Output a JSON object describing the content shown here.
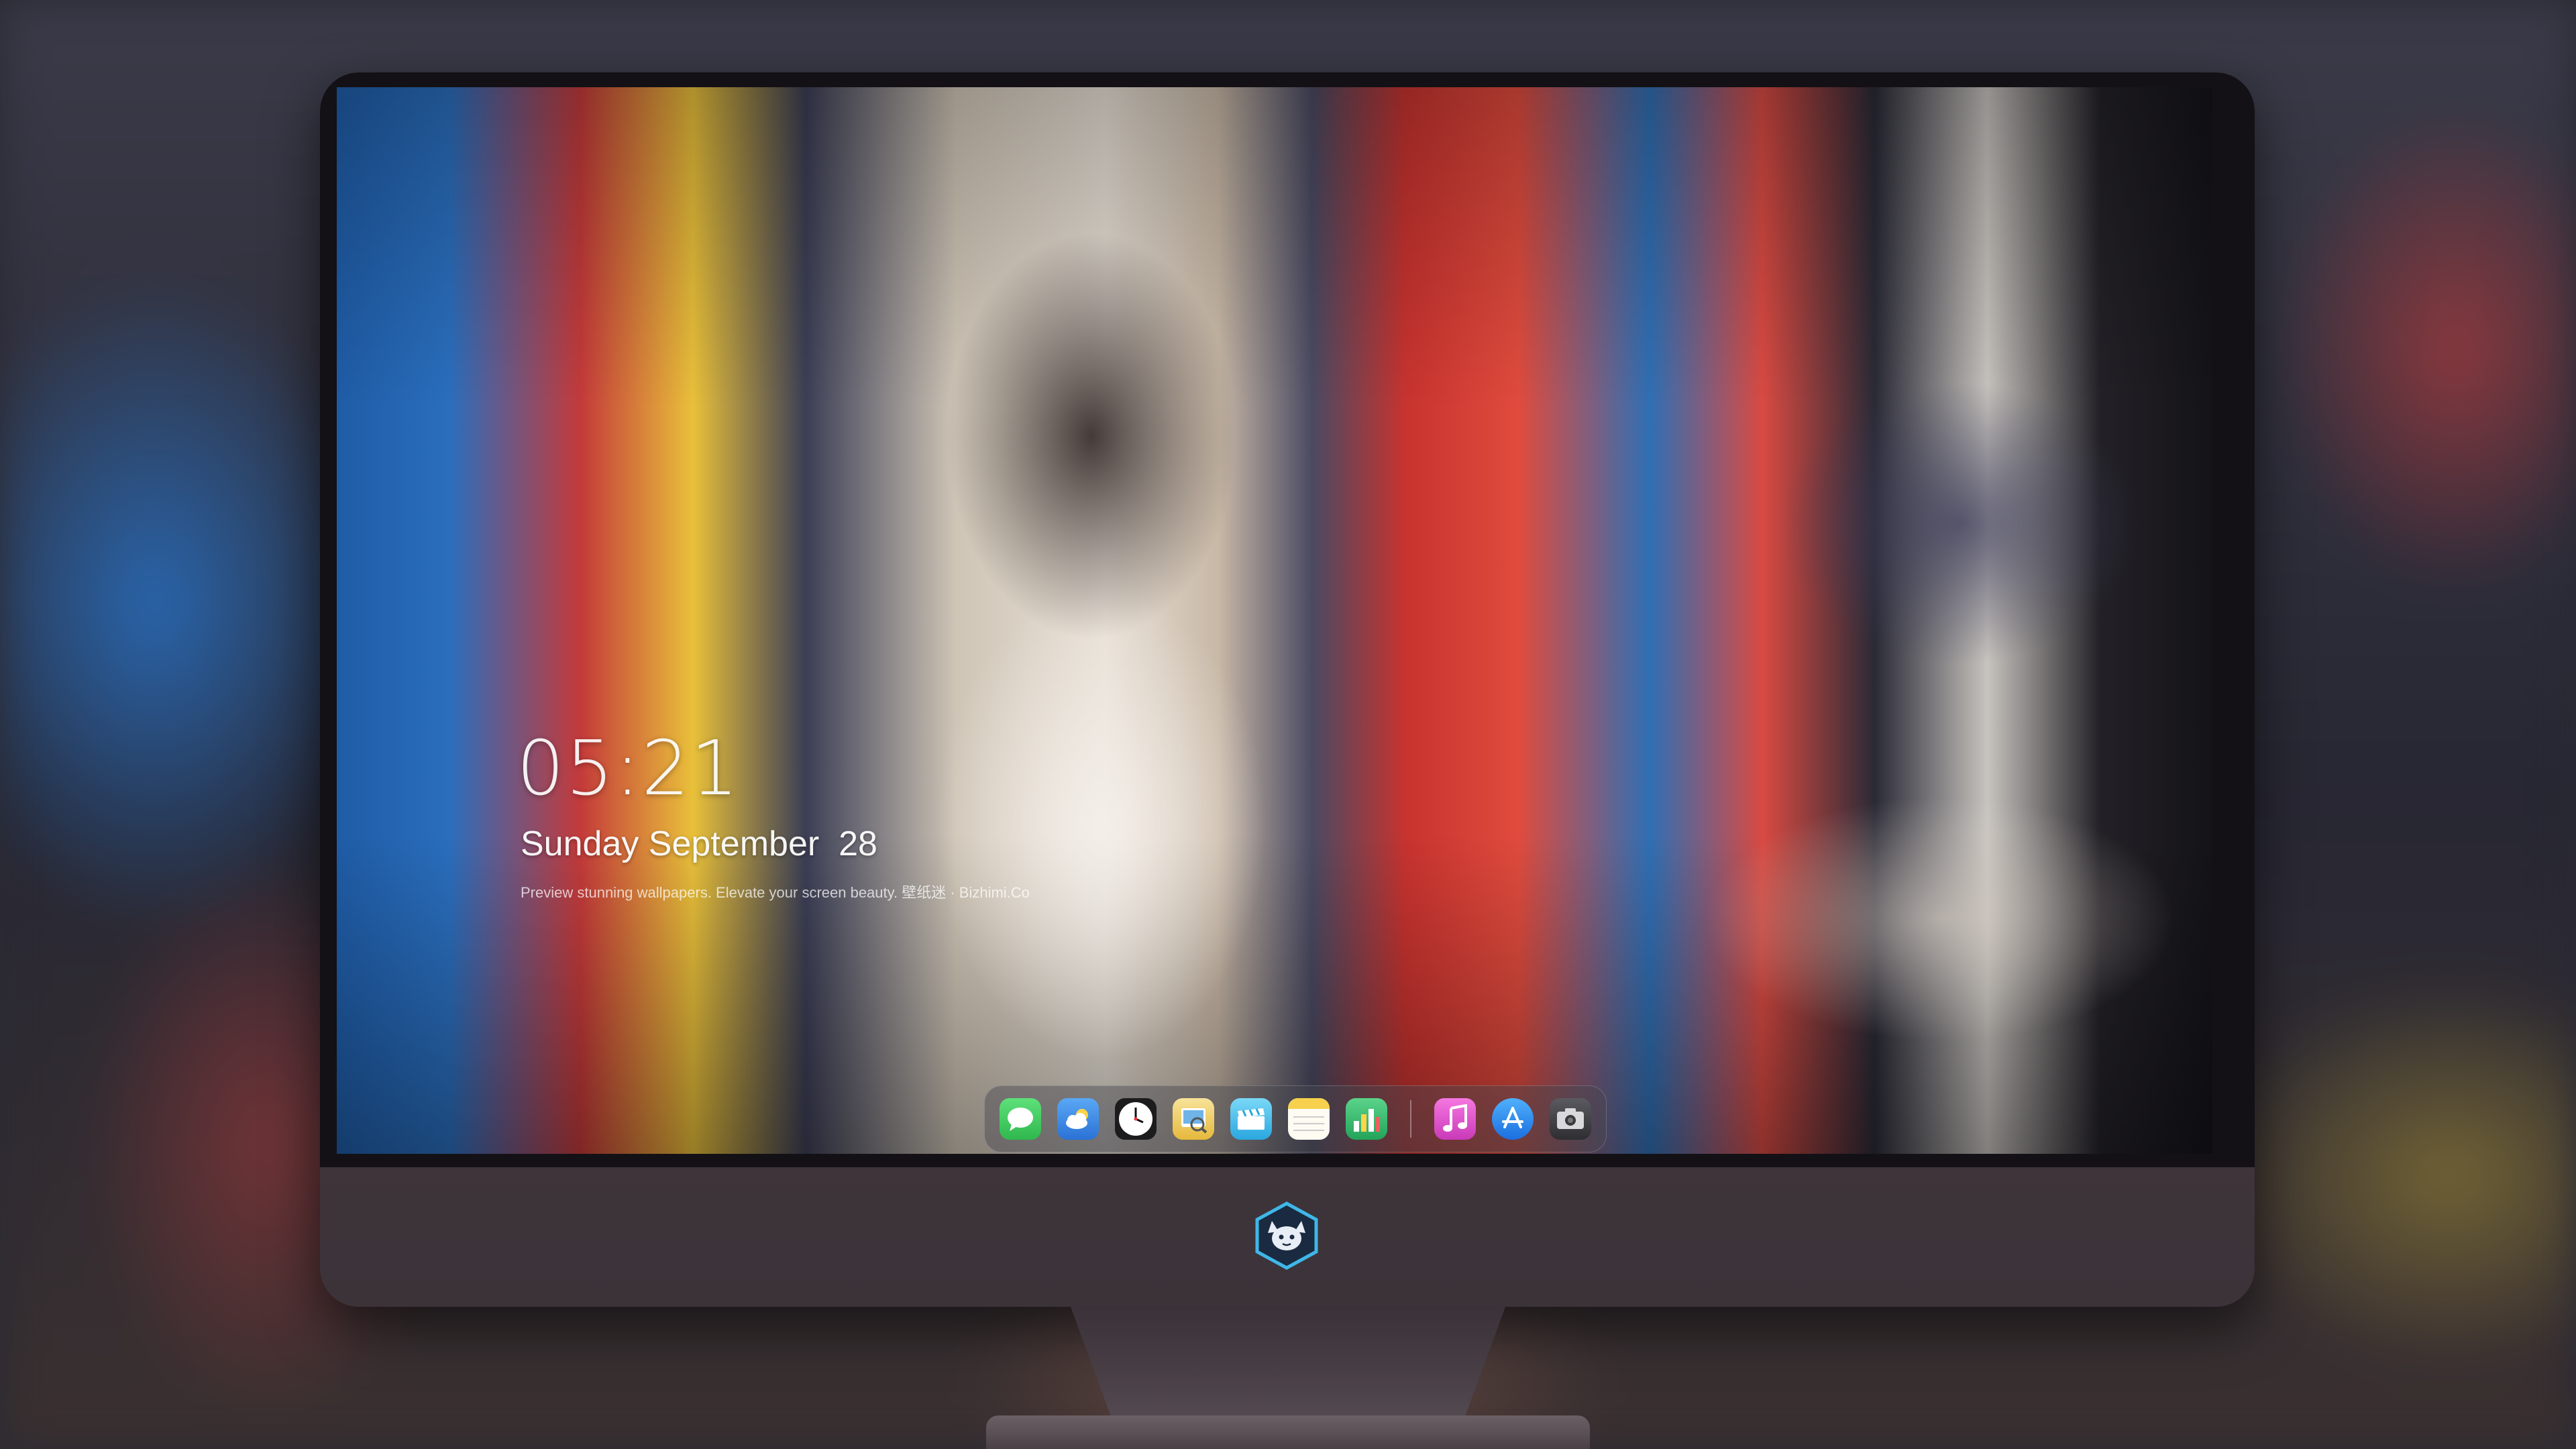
{
  "lock_screen": {
    "time": "05:21",
    "date": "Sunday September  28",
    "tagline": "Preview stunning wallpapers. Elevate your screen beauty. 壁纸迷 · Bizhimi.Co"
  },
  "dock": {
    "items": [
      {
        "icon": "messages-icon",
        "color": "#34c759"
      },
      {
        "icon": "weather-icon",
        "color": "#3d8de8"
      },
      {
        "icon": "clock-icon",
        "color": "#ffffff"
      },
      {
        "icon": "preview-icon",
        "color": "#f2c84b"
      },
      {
        "icon": "clips-icon",
        "color": "#3ab6e6"
      },
      {
        "icon": "notes-icon",
        "color": "#f7d14e"
      },
      {
        "icon": "numbers-icon",
        "color": "#2fb567"
      },
      {
        "icon": "music-icon",
        "color": "#e94cc8"
      },
      {
        "icon": "app-store-icon",
        "color": "#2c8cf4"
      },
      {
        "icon": "camera-icon",
        "color": "#3b3b3f"
      }
    ]
  },
  "brand": {
    "logo_icon": "fox-mascot-logo-icon",
    "accent": "#3fb7e8"
  }
}
